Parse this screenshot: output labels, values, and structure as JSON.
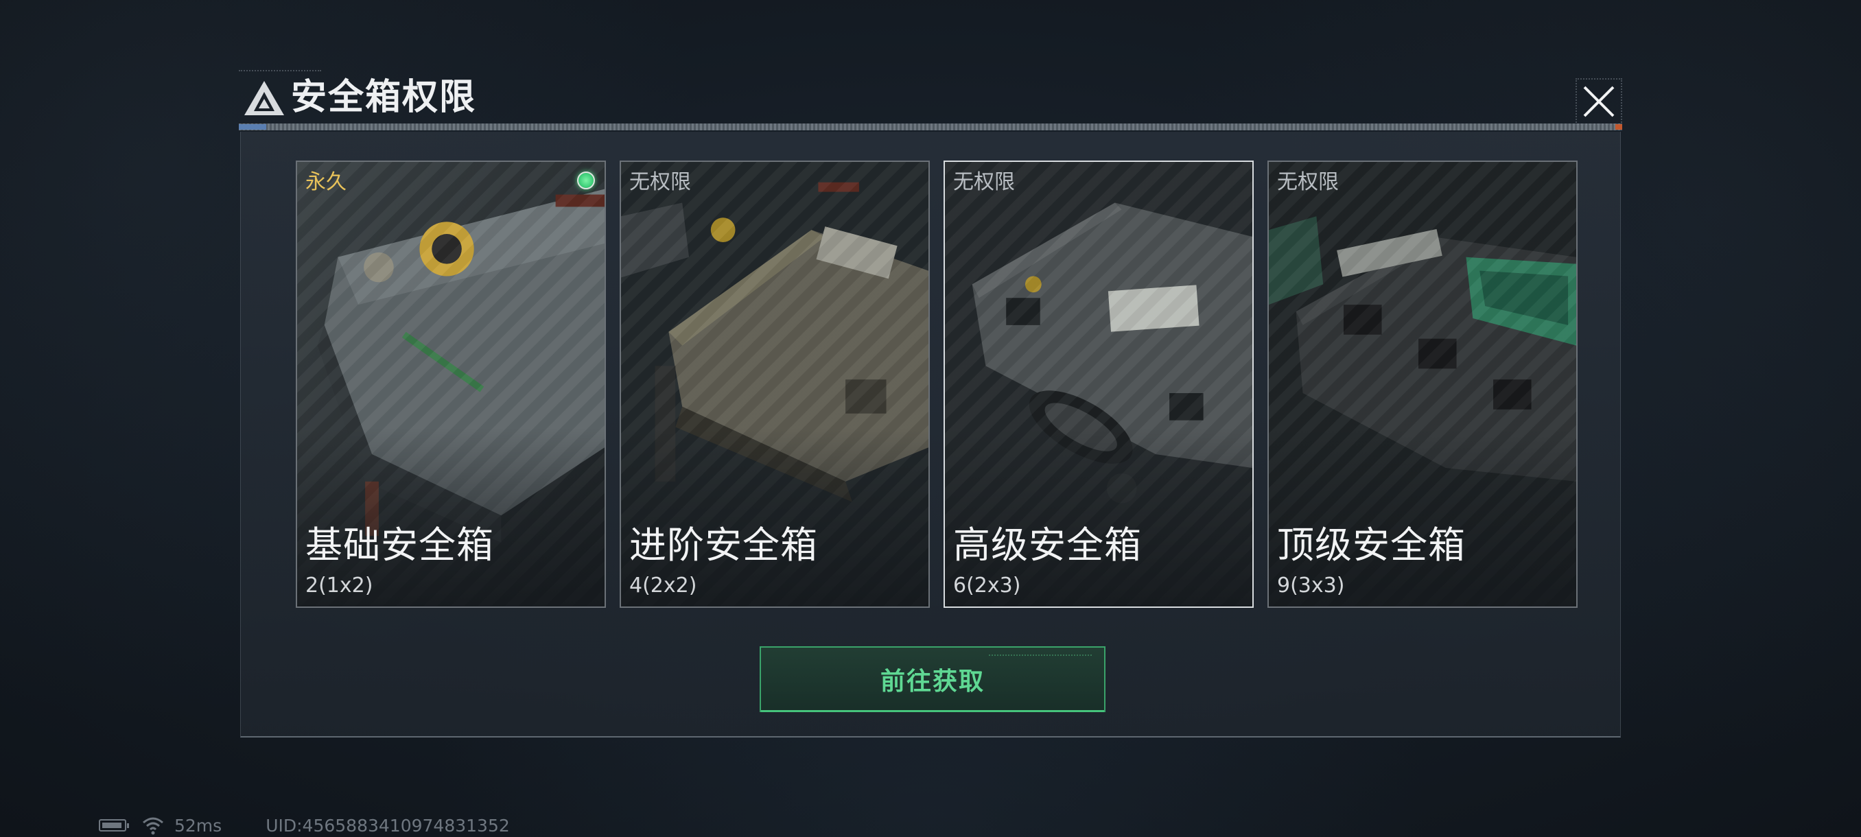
{
  "dialog": {
    "title": "安全箱权限",
    "close_icon": "close-icon",
    "cards": [
      {
        "status": "永久",
        "name": "基础安全箱",
        "capacity": "2(1x2)",
        "selected": false,
        "active": true
      },
      {
        "status": "无权限",
        "name": "进阶安全箱",
        "capacity": "4(2x2)",
        "selected": false,
        "active": false
      },
      {
        "status": "无权限",
        "name": "高级安全箱",
        "capacity": "6(2x3)",
        "selected": true,
        "active": false
      },
      {
        "status": "无权限",
        "name": "顶级安全箱",
        "capacity": "9(3x3)",
        "selected": false,
        "active": false
      }
    ],
    "action_label": "前往获取"
  },
  "status_bar": {
    "battery_icon": "battery-icon",
    "wifi_icon": "wifi-icon",
    "ping": "52ms",
    "uid": "UID:4565883410974831352"
  },
  "colors": {
    "accent_green": "#5fd893",
    "permanent_gold": "#e8c25a"
  }
}
